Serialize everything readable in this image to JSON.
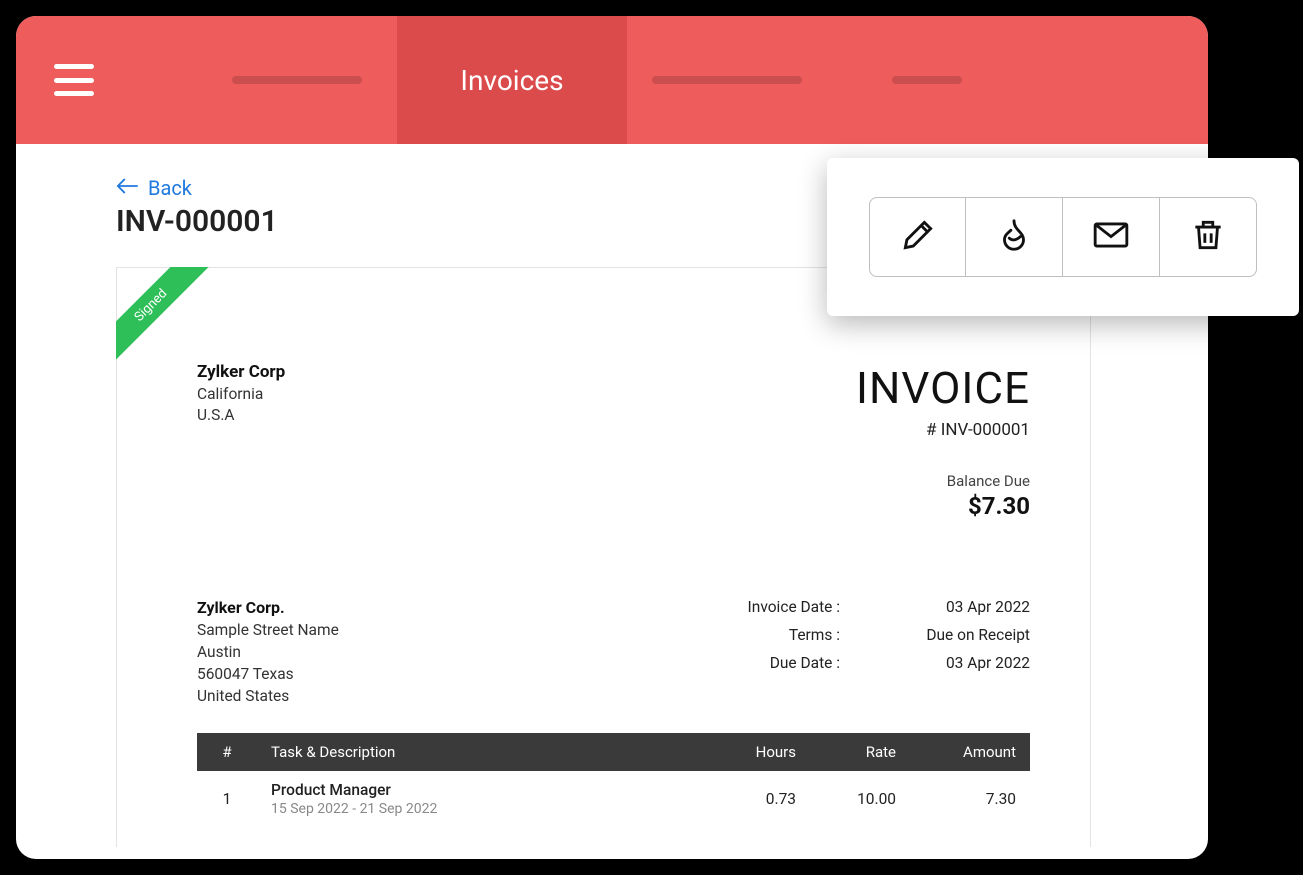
{
  "header": {
    "active_tab_label": "Invoices"
  },
  "page": {
    "back_label": "Back",
    "record_id": "INV-000001"
  },
  "invoice": {
    "ribbon": "Signed",
    "from": {
      "name": "Zylker Corp",
      "line1": "California",
      "line2": "U.S.A"
    },
    "title_word": "INVOICE",
    "title_num": "# INV-000001",
    "balance_label": "Balance Due",
    "balance_value": "$7.30",
    "to": {
      "name": "Zylker Corp.",
      "line1": "Sample Street Name",
      "line2": "Austin",
      "line3": "560047 Texas",
      "line4": "United States"
    },
    "meta": {
      "k1": "Invoice Date :",
      "v1": "03 Apr 2022",
      "k2": "Terms :",
      "v2": "Due on Receipt",
      "k3": "Due Date :",
      "v3": "03 Apr 2022"
    },
    "columns": {
      "c1": "#",
      "c2": "Task & Description",
      "c3": "Hours",
      "c4": "Rate",
      "c5": "Amount"
    },
    "row": {
      "num": "1",
      "task": "Product Manager",
      "sub": "15 Sep 2022 - 21 Sep 2022",
      "hours": "0.73",
      "rate": "10.00",
      "amount": "7.30"
    }
  }
}
